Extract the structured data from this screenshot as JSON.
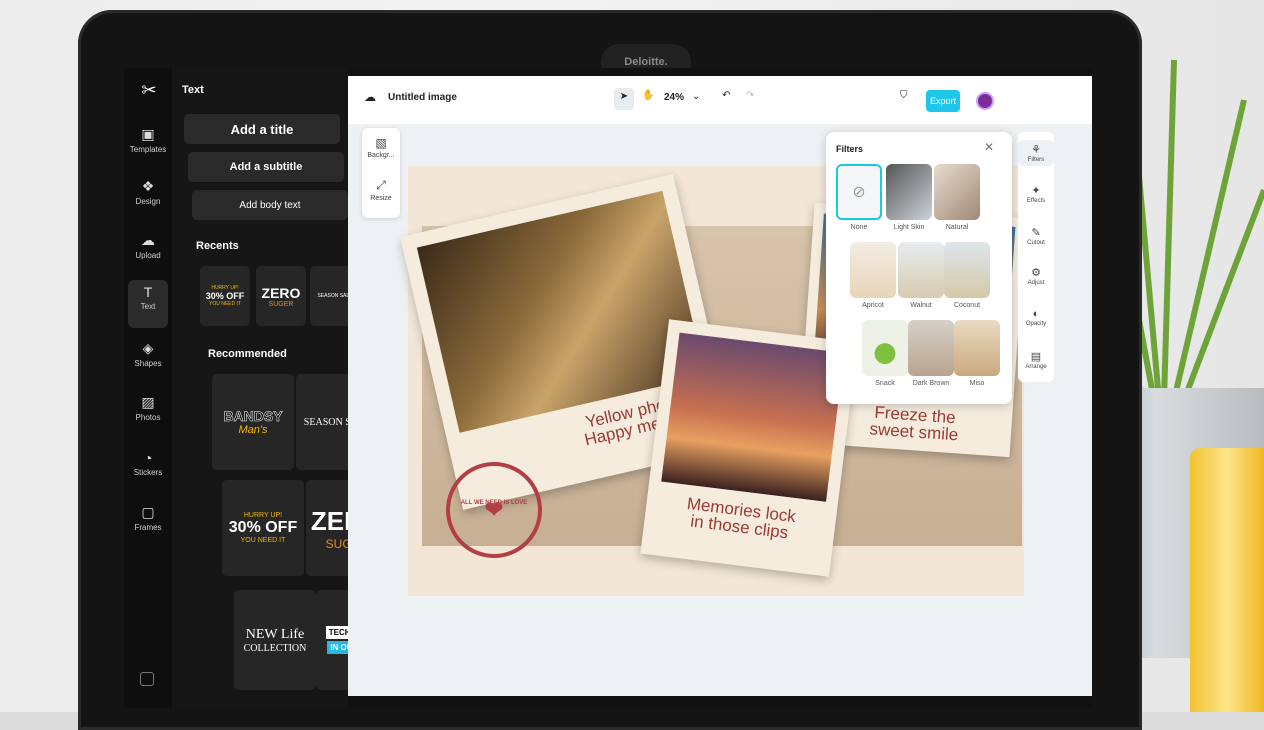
{
  "device": {
    "camera_label": "Deloitte."
  },
  "rail": {
    "items": [
      {
        "label": "Templates",
        "icon": "templates-icon"
      },
      {
        "label": "Design",
        "icon": "design-icon"
      },
      {
        "label": "Upload",
        "icon": "upload-icon"
      },
      {
        "label": "Text",
        "icon": "text-icon"
      },
      {
        "label": "Shapes",
        "icon": "shapes-icon"
      },
      {
        "label": "Photos",
        "icon": "photos-icon"
      },
      {
        "label": "Stickers",
        "icon": "stickers-icon"
      },
      {
        "label": "Frames",
        "icon": "frames-icon"
      }
    ]
  },
  "panel": {
    "title": "Text",
    "add_title": "Add a title",
    "add_subtitle": "Add a subtitle",
    "add_body": "Add body text",
    "recents_label": "Recents",
    "recommended_label": "Recommended",
    "recents": [
      {
        "line1": "HURRY UP!",
        "line2": "30% OFF",
        "line3": "YOU NEED IT"
      },
      {
        "line1": "ZERO",
        "line2": "SUGER"
      },
      {
        "line1": "SEASON SALE"
      }
    ],
    "recommended": [
      {
        "line1": "BANDSY",
        "line2": "Man's"
      },
      {
        "line1": "SEASON SALE"
      },
      {
        "line1": "HURRY UP!",
        "line2": "30% OFF",
        "line3": "YOU NEED IT"
      },
      {
        "line1": "ZERO",
        "line2": "SUGER"
      },
      {
        "line1": "NEW Life",
        "line2": "COLLECTION"
      },
      {
        "line1": "TECHNOLOGY",
        "line2": "IN OUR LIVES"
      }
    ]
  },
  "topbar": {
    "doc_title": "Untitled image",
    "zoom": "24%",
    "export_label": "Export"
  },
  "sidetools": {
    "background": "Backgr...",
    "resize": "Resize"
  },
  "canvas": {
    "caption1_line1": "Yellow pho",
    "caption1_line2": "Happy mem",
    "caption2_line1": "Memories lock",
    "caption2_line2": "in those clips",
    "caption3_line1": "Freeze the",
    "caption3_line2": "sweet smile",
    "stamp_text": "ALL WE NEED IS LOVE"
  },
  "filters": {
    "title": "Filters",
    "items": [
      "None",
      "Light Skin",
      "Natural",
      "Apricot",
      "Walnut",
      "Coconut",
      "Snack",
      "Dark Brown",
      "Miso"
    ]
  },
  "rightrail": {
    "items": [
      "Filters",
      "Effects",
      "Cutout",
      "Adjust",
      "Opacity",
      "Arrange"
    ]
  },
  "colors": {
    "accent": "#1ec6ea",
    "caption": "#9a3b34"
  }
}
